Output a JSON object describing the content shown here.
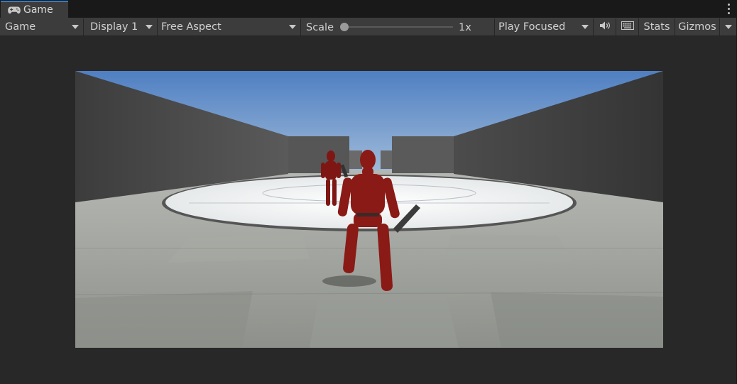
{
  "tab": {
    "icon": "gamepad-icon",
    "label": "Game"
  },
  "toolbar": {
    "view_select": "Game",
    "display_select": "Display 1",
    "aspect_select": "Free Aspect",
    "scale_label": "Scale",
    "scale_value": "1x",
    "scale_slider_level": 0.0,
    "play_mode_select": "Play Focused",
    "audio_icon": "speaker-icon",
    "keyboard_icon": "keyboard-icon",
    "stats_label": "Stats",
    "gizmos_label": "Gizmos"
  },
  "menu_icon": "kebab-menu-icon",
  "scene": {
    "sky_color": "#5b89c6",
    "floor_color": "#9fa29c",
    "wall_color": "#4a4a4a",
    "arena_color": "#eef0f0",
    "character_color": "#8a1a15"
  }
}
